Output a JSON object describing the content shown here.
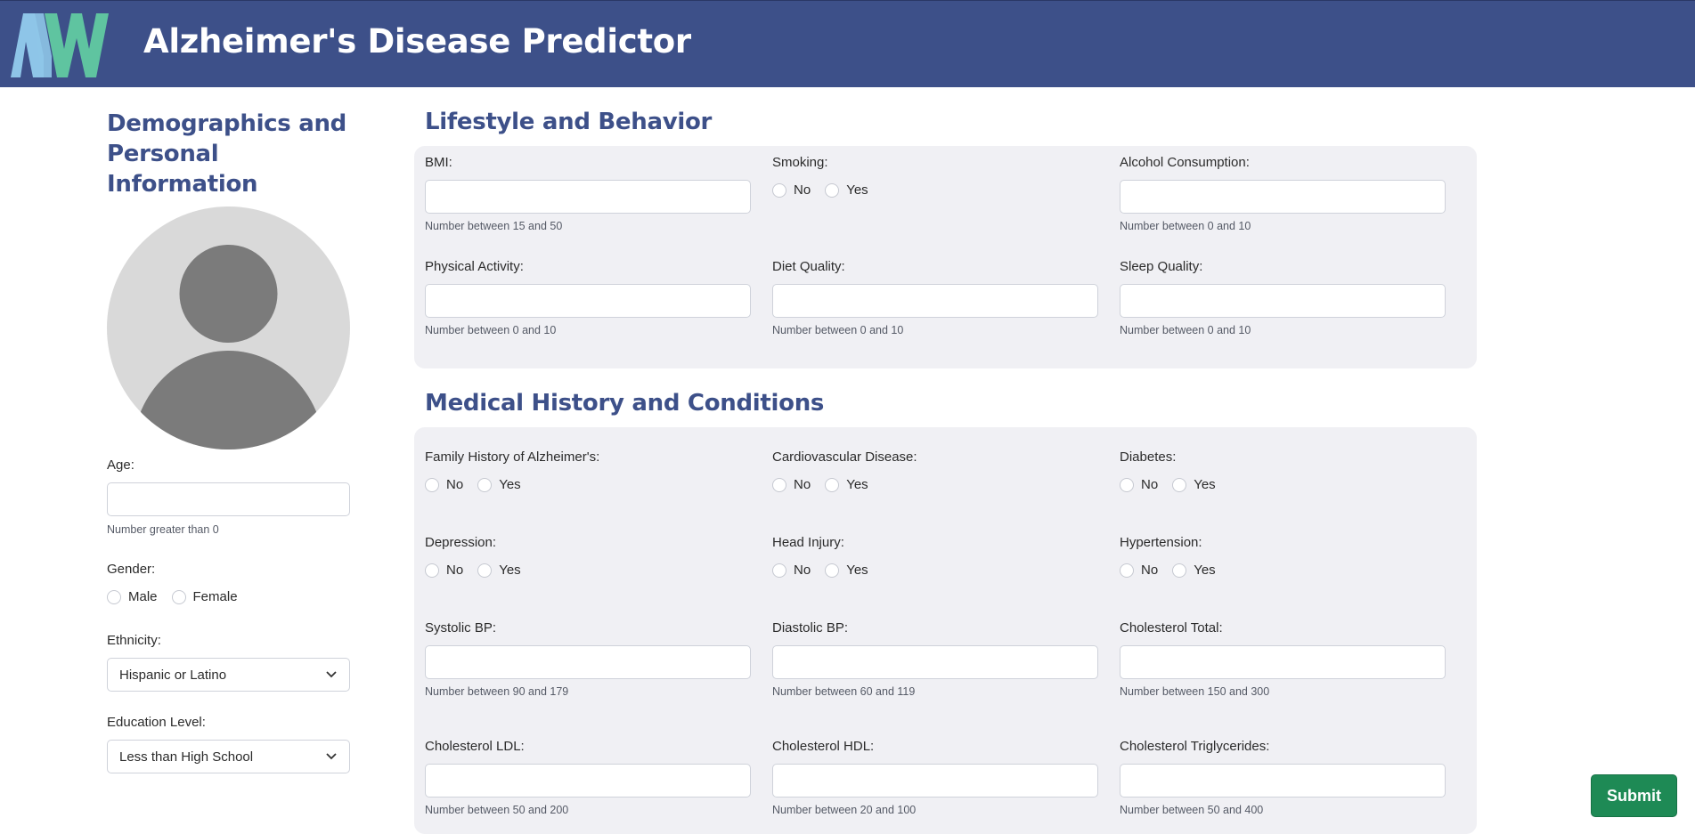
{
  "header": {
    "title": "Alzheimer's Disease Predictor",
    "logo_icon": "mw-logo-icon"
  },
  "demographics": {
    "title": "Demographics and Personal Information",
    "title_lines": [
      "Demographics and",
      "Personal",
      "Information"
    ],
    "age": {
      "label": "Age:",
      "value": "",
      "hint": "Number greater than 0"
    },
    "gender": {
      "label": "Gender:",
      "options": [
        "Male",
        "Female"
      ]
    },
    "ethnicity": {
      "label": "Ethnicity:",
      "selected": "Hispanic or Latino"
    },
    "education": {
      "label": "Education Level:",
      "selected": "Less than High School"
    }
  },
  "lifestyle": {
    "title": "Lifestyle and Behavior",
    "bmi": {
      "label": "BMI:",
      "value": "",
      "hint": "Number between 15 and 50"
    },
    "smoking": {
      "label": "Smoking:",
      "options": [
        "No",
        "Yes"
      ]
    },
    "alcohol": {
      "label": "Alcohol Consumption:",
      "value": "",
      "hint": "Number between 0 and 10"
    },
    "physical": {
      "label": "Physical Activity:",
      "value": "",
      "hint": "Number between 0 and 10"
    },
    "diet": {
      "label": "Diet Quality:",
      "value": "",
      "hint": "Number between 0 and 10"
    },
    "sleep": {
      "label": "Sleep Quality:",
      "value": "",
      "hint": "Number between 0 and 10"
    }
  },
  "medical": {
    "title": "Medical History and Conditions",
    "family_history": {
      "label": "Family History of Alzheimer's:",
      "options": [
        "No",
        "Yes"
      ]
    },
    "cardio": {
      "label": "Cardiovascular Disease:",
      "options": [
        "No",
        "Yes"
      ]
    },
    "diabetes": {
      "label": "Diabetes:",
      "options": [
        "No",
        "Yes"
      ]
    },
    "depression": {
      "label": "Depression:",
      "options": [
        "No",
        "Yes"
      ]
    },
    "head_injury": {
      "label": "Head Injury:",
      "options": [
        "No",
        "Yes"
      ]
    },
    "hypertension": {
      "label": "Hypertension:",
      "options": [
        "No",
        "Yes"
      ]
    },
    "systolic": {
      "label": "Systolic BP:",
      "value": "",
      "hint": "Number between 90 and 179"
    },
    "diastolic": {
      "label": "Diastolic BP:",
      "value": "",
      "hint": "Number between 60 and 119"
    },
    "chol_total": {
      "label": "Cholesterol Total:",
      "value": "",
      "hint": "Number between 150 and 300"
    },
    "chol_ldl": {
      "label": "Cholesterol LDL:",
      "value": "",
      "hint": "Number between 50 and 200"
    },
    "chol_hdl": {
      "label": "Cholesterol HDL:",
      "value": "",
      "hint": "Number between 20 and 100"
    },
    "chol_tri": {
      "label": "Cholesterol Triglycerides:",
      "value": "",
      "hint": "Number between 50 and 400"
    }
  },
  "actions": {
    "submit_label": "Submit"
  },
  "colors": {
    "header_bg": "#3d5089",
    "title_color": "#3d5089",
    "panel_bg": "#f0f0f4",
    "submit_bg": "#1e8a55",
    "logo_blue": "#8ec5e8",
    "logo_green": "#5fc4a0"
  }
}
